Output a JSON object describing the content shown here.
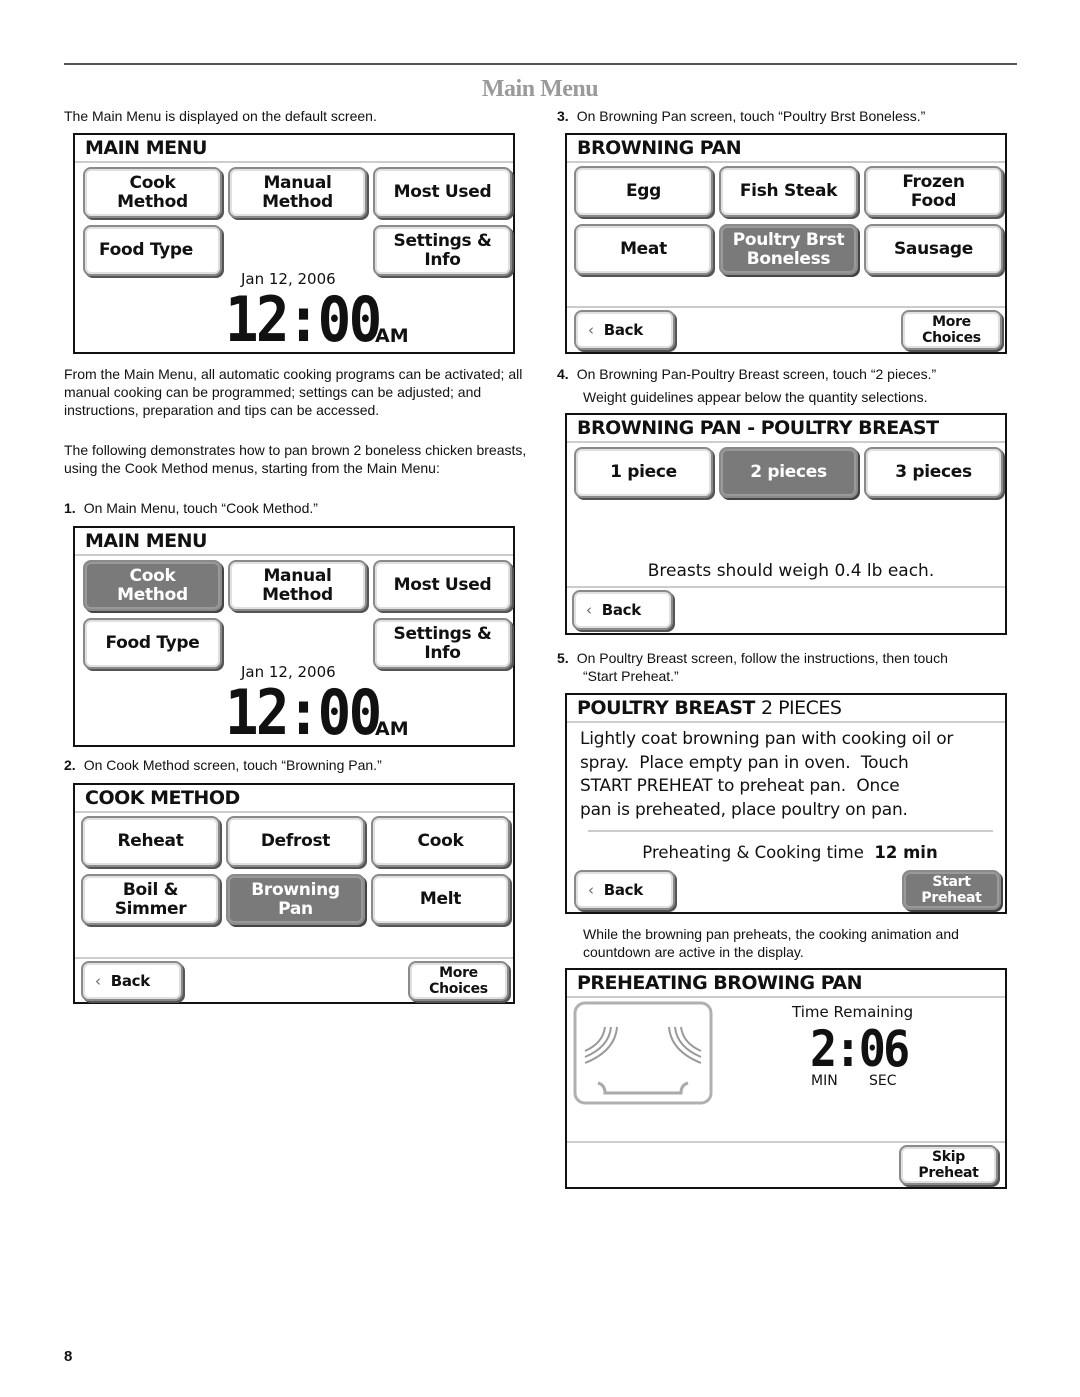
{
  "page": {
    "title": "Main Menu",
    "page_number": "8"
  },
  "intro": "The Main Menu is displayed on the default screen.",
  "paragraphs": {
    "p1": "From the Main Menu, all automatic cooking programs can be activated; all manual cooking can be programmed; settings can be adjusted; and instructions, preparation and tips can be accessed.",
    "p2": "The following demonstrates how to pan brown 2 boneless chicken breasts, using the Cook Method menus, starting from the Main Menu:",
    "note": "While the browning pan preheats, the cooking animation and countdown are active in the display."
  },
  "steps": [
    {
      "num": "1.",
      "text": "On Main Menu, touch “Cook Method.”"
    },
    {
      "num": "2.",
      "text": "On Cook Method screen, touch “Browning Pan.”"
    },
    {
      "num": "3.",
      "text": "On Browning Pan screen, touch “Poultry Brst Boneless.”"
    },
    {
      "num": "4.",
      "text": "On Browning Pan-Poultry Breast screen, touch “2 pieces.”",
      "text2": "Weight guidelines appear below the quantity selections."
    },
    {
      "num": "5.",
      "text": "On Poultry Breast screen, follow the instructions, then touch",
      "text2": "“Start Preheat.”"
    }
  ],
  "screens": {
    "main_menu_1": {
      "title": "MAIN MENU",
      "buttons": {
        "cook_method": [
          "Cook",
          "Method"
        ],
        "manual_method": [
          "Manual",
          "Method"
        ],
        "most_used": "Most Used",
        "food_type": "Food Type",
        "settings_info": [
          "Settings &",
          "Info"
        ]
      },
      "date": "Jan 12, 2006",
      "time": "12:00",
      "ampm": "AM"
    },
    "main_menu_2": {
      "title": "MAIN MENU",
      "selected": "Cook Method",
      "buttons": {
        "cook_method": [
          "Cook",
          "Method"
        ],
        "manual_method": [
          "Manual",
          "Method"
        ],
        "most_used": "Most Used",
        "food_type": "Food Type",
        "settings_info": [
          "Settings &",
          "Info"
        ]
      },
      "date": "Jan 12, 2006",
      "time": "12:00",
      "ampm": "AM"
    },
    "cook_method": {
      "title": "COOK METHOD",
      "selected": "Browning Pan",
      "buttons": {
        "reheat": "Reheat",
        "defrost": "Defrost",
        "cook": "Cook",
        "boil_simmer": [
          "Boil &",
          "Simmer"
        ],
        "browning_pan": [
          "Browning",
          "Pan"
        ],
        "melt": "Melt"
      },
      "back": "Back",
      "more_choices": [
        "More",
        "Choices"
      ]
    },
    "browning_pan": {
      "title": "BROWNING PAN",
      "selected": "Poultry Brst Boneless",
      "buttons": {
        "egg": "Egg",
        "fish_steak": "Fish Steak",
        "frozen_food": [
          "Frozen",
          "Food"
        ],
        "meat": "Meat",
        "poultry": [
          "Poultry Brst",
          "Boneless"
        ],
        "sausage": "Sausage"
      },
      "back": "Back",
      "more_choices": [
        "More",
        "Choices"
      ]
    },
    "poultry_breast": {
      "title": "BROWNING PAN - POULTRY BREAST",
      "selected": "2 pieces",
      "buttons": {
        "one": "1 piece",
        "two": "2 pieces",
        "three": "3 pieces"
      },
      "guideline": "Breasts should weigh 0.4 lb each.",
      "back": "Back"
    },
    "poultry_2pieces": {
      "title_bold": "POULTRY BREAST",
      "title_normal": "2 PIECES",
      "lines": [
        "Lightly coat browning pan with cooking oil or",
        "spray.  Place empty pan in oven.  Touch",
        "START PREHEAT to preheat pan.  Once",
        "pan is preheated, place poultry on pan."
      ],
      "time_label": "Preheating & Cooking time",
      "time_value": "12 min",
      "back": "Back",
      "start_preheat": [
        "Start",
        "Preheat"
      ]
    },
    "preheating": {
      "title": "PREHEATING BROWING PAN",
      "time_remaining_label": "Time Remaining",
      "countdown": "2:06",
      "min_label": "MIN",
      "sec_label": "SEC",
      "skip_preheat": [
        "Skip",
        "Preheat"
      ]
    }
  },
  "colors": {
    "selected_button": "#7a7a7a",
    "title_gray": "#9a9a9a"
  }
}
